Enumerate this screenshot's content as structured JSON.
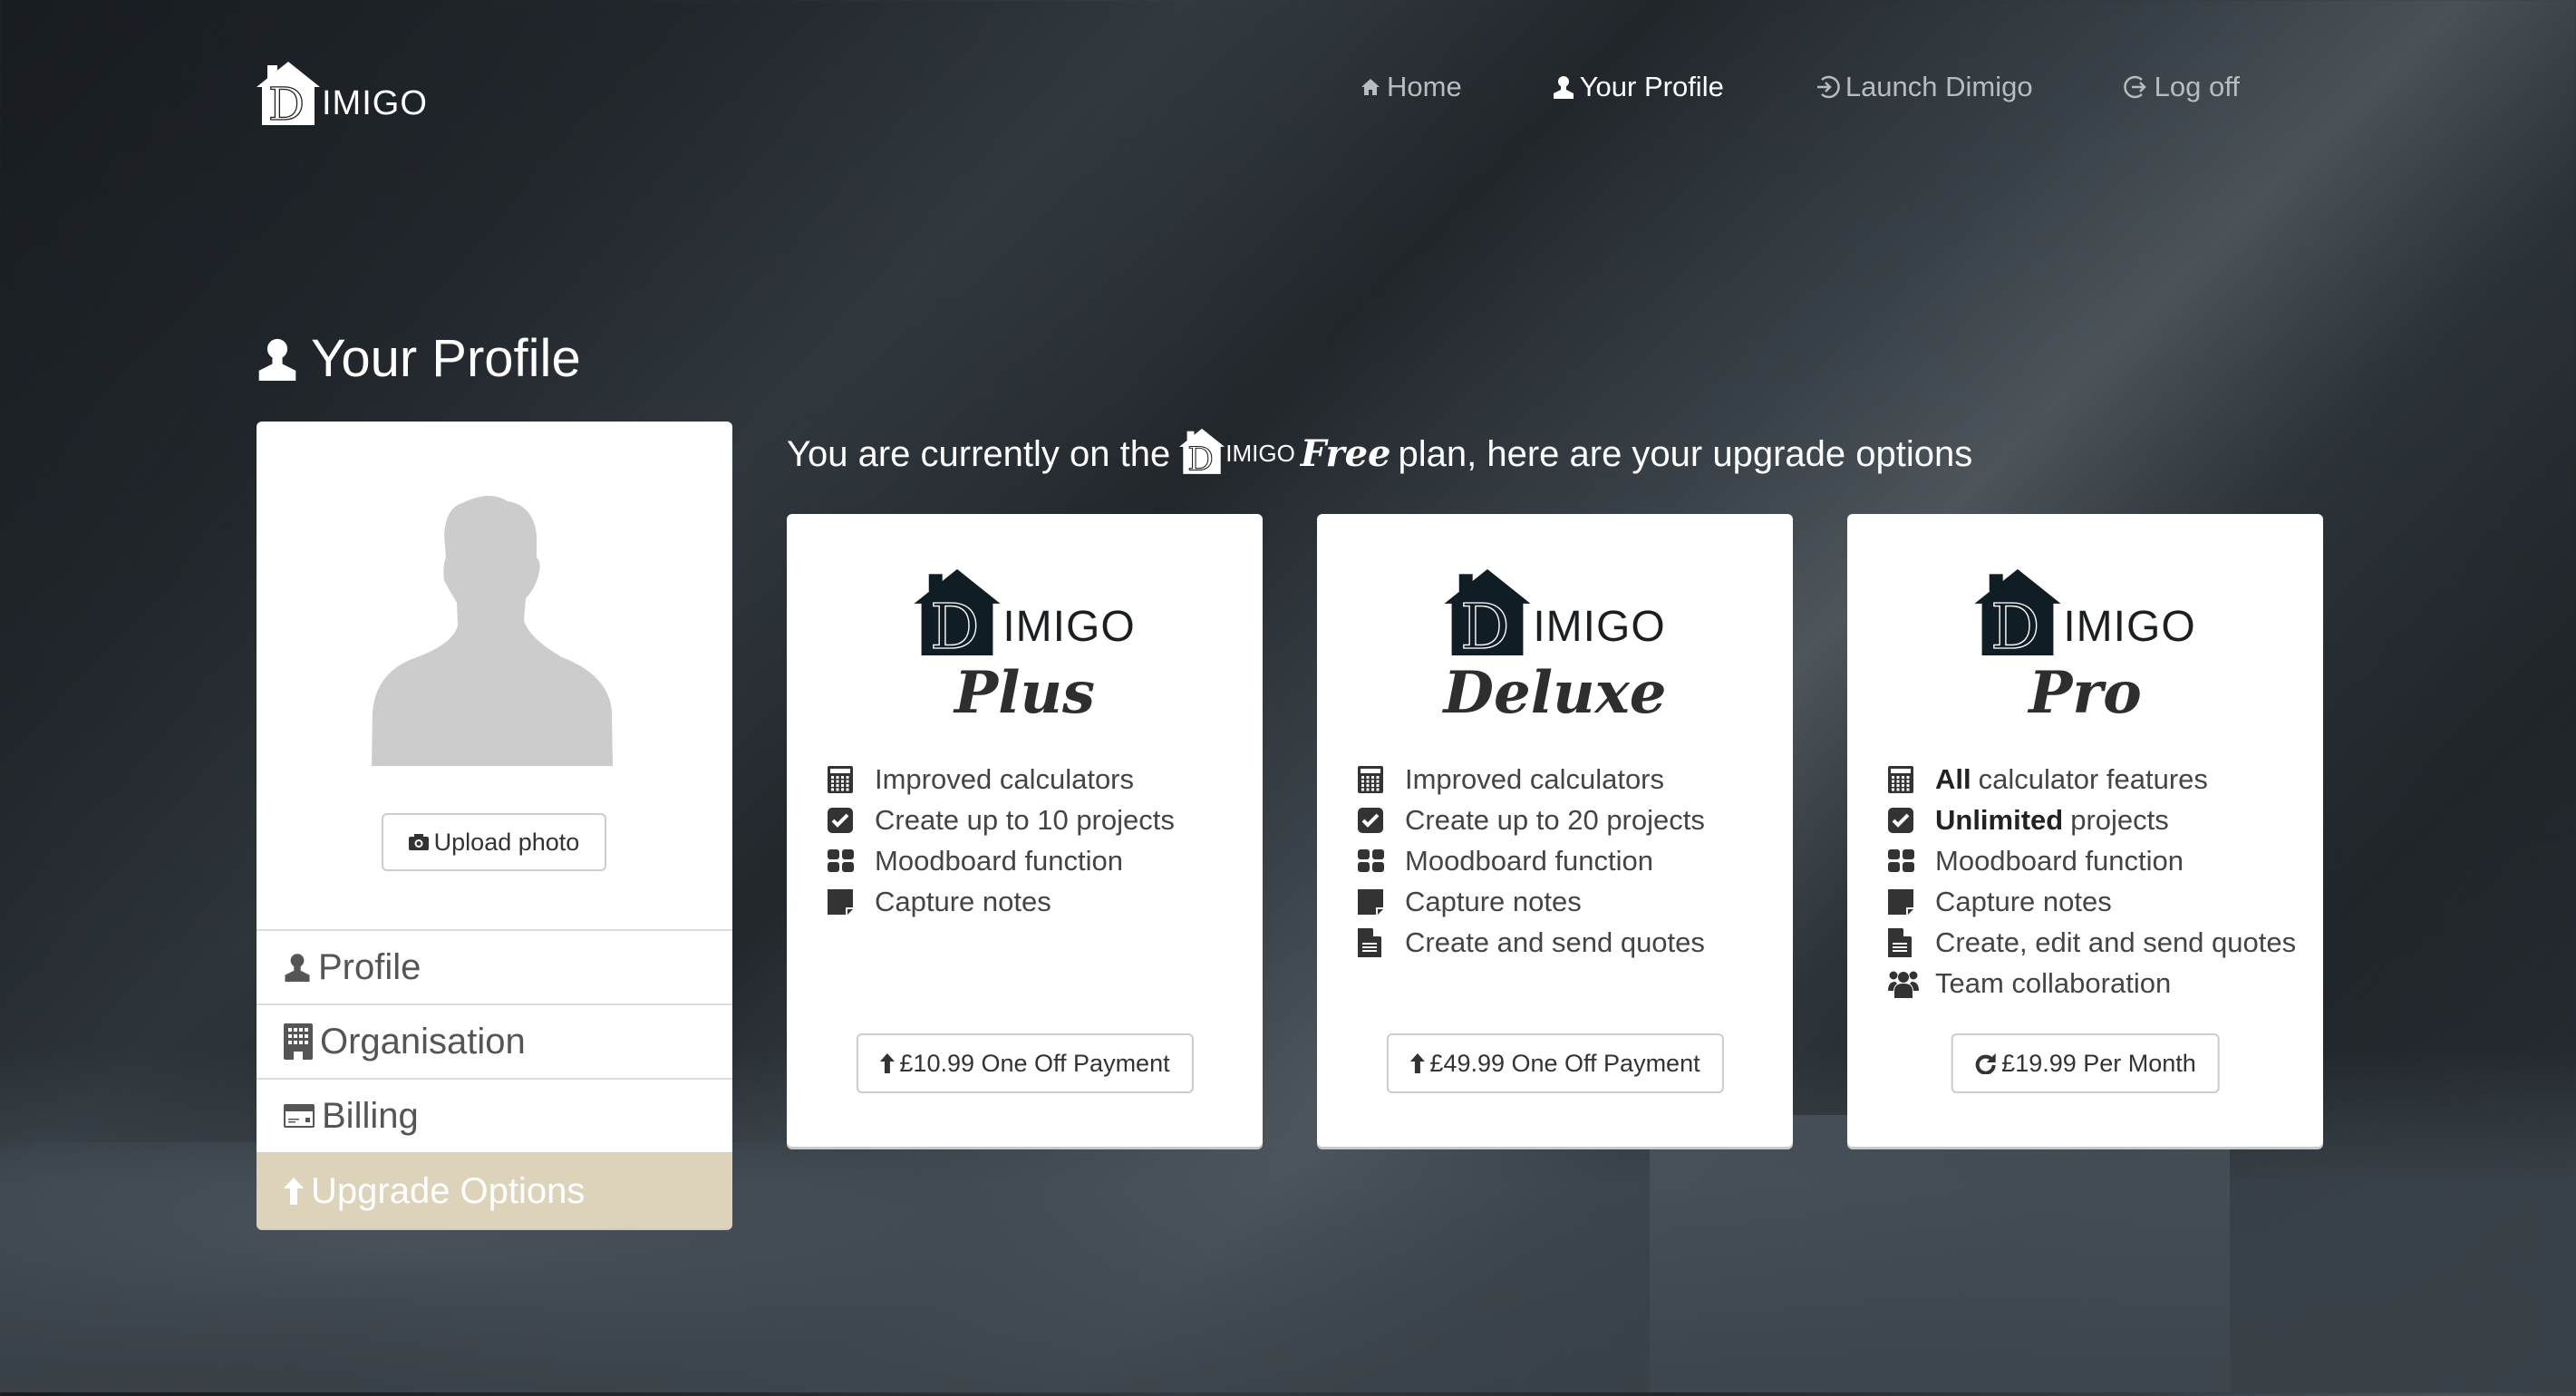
{
  "brand": {
    "logo_letter": "D",
    "logo_text": "IMIGO"
  },
  "nav": {
    "items": [
      {
        "label": "Home",
        "icon": "home-icon",
        "active": false
      },
      {
        "label": "Your Profile",
        "icon": "user-icon",
        "active": true
      },
      {
        "label": "Launch Dimigo",
        "icon": "log-in-icon",
        "active": false
      },
      {
        "label": "Log off",
        "icon": "log-out-icon",
        "active": false
      }
    ]
  },
  "page": {
    "title": "Your Profile"
  },
  "profile_panel": {
    "upload_label": "Upload photo",
    "menu": [
      {
        "label": "Profile",
        "icon": "user-icon",
        "active": false
      },
      {
        "label": "Organisation",
        "icon": "building-icon",
        "active": false
      },
      {
        "label": "Billing",
        "icon": "credit-card-icon",
        "active": false
      },
      {
        "label": "Upgrade Options",
        "icon": "arrow-up-icon",
        "active": true
      }
    ]
  },
  "upgrade": {
    "intro_before": "You are currently on the",
    "current_plan": "Free",
    "intro_after": "plan, here are your upgrade options",
    "plans": [
      {
        "name": "Plus",
        "features": [
          {
            "icon": "calculator-icon",
            "bold": "",
            "text": "Improved calculators"
          },
          {
            "icon": "checkbox-icon",
            "bold": "",
            "text": "Create up to 10 projects"
          },
          {
            "icon": "grid-icon",
            "bold": "",
            "text": "Moodboard function"
          },
          {
            "icon": "note-icon",
            "bold": "",
            "text": "Capture notes"
          }
        ],
        "button_icon": "arrow-up-icon",
        "button_label": "£10.99 One Off Payment"
      },
      {
        "name": "Deluxe",
        "features": [
          {
            "icon": "calculator-icon",
            "bold": "",
            "text": "Improved calculators"
          },
          {
            "icon": "checkbox-icon",
            "bold": "",
            "text": "Create up to 20 projects"
          },
          {
            "icon": "grid-icon",
            "bold": "",
            "text": "Moodboard function"
          },
          {
            "icon": "note-icon",
            "bold": "",
            "text": "Capture notes"
          },
          {
            "icon": "document-icon",
            "bold": "",
            "text": "Create and send quotes"
          }
        ],
        "button_icon": "arrow-up-icon",
        "button_label": "£49.99 One Off Payment"
      },
      {
        "name": "Pro",
        "features": [
          {
            "icon": "calculator-icon",
            "bold": "All",
            "text": "calculator features"
          },
          {
            "icon": "checkbox-icon",
            "bold": "Unlimited",
            "text": "projects"
          },
          {
            "icon": "grid-icon",
            "bold": "",
            "text": "Moodboard function"
          },
          {
            "icon": "note-icon",
            "bold": "",
            "text": "Capture notes"
          },
          {
            "icon": "document-icon",
            "bold": "",
            "text": "Create, edit and send quotes"
          },
          {
            "icon": "users-icon",
            "bold": "",
            "text": "Team collaboration"
          }
        ],
        "button_icon": "refresh-icon",
        "button_label": "£19.99 Per Month"
      }
    ]
  },
  "colors": {
    "accent": "#ddd3bb",
    "card_text": "#444444",
    "logo_dark": "#111d24"
  }
}
